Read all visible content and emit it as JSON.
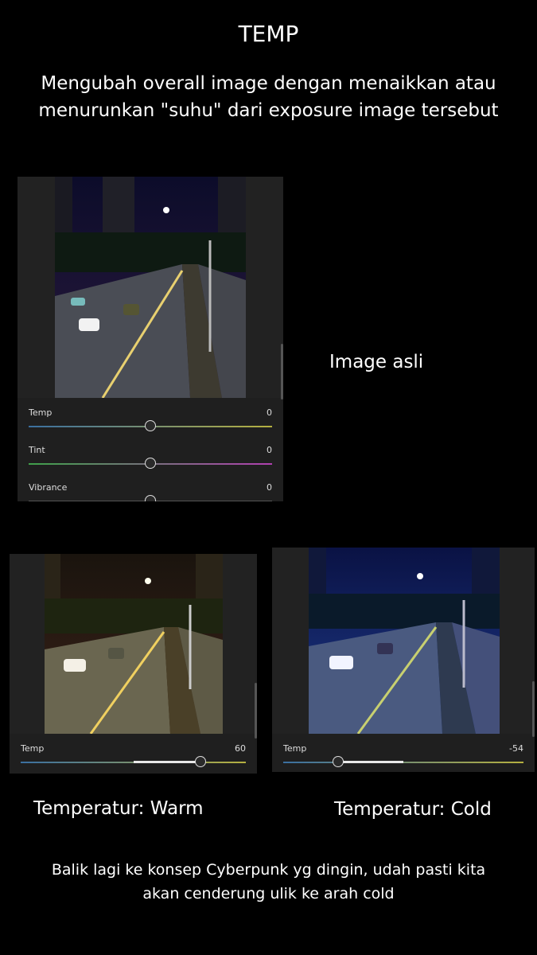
{
  "title": "TEMP",
  "subtitle": "Mengubah overall image dengan menaikkan atau menurunkan \"suhu\" dari exposure image tersebut",
  "original": {
    "caption": "Image asli",
    "sliders": [
      {
        "label": "Temp",
        "value": "0",
        "position": 0.5,
        "gradient": [
          "#3a6fa0",
          "#b5b040"
        ]
      },
      {
        "label": "Tint",
        "value": "0",
        "position": 0.5,
        "gradient": [
          "#3fa04a",
          "#b040b0"
        ]
      },
      {
        "label": "Vibrance",
        "value": "0",
        "position": 0.5,
        "gradient": [
          "#555555",
          "#555555"
        ]
      }
    ]
  },
  "warm": {
    "caption": "Temperatur: Warm",
    "slider": {
      "label": "Temp",
      "value": "60",
      "position": 0.8,
      "gradient": [
        "#3a6fa0",
        "#b5b040"
      ]
    }
  },
  "cold": {
    "caption": "Temperatur: Cold",
    "slider": {
      "label": "Temp",
      "value": "-54",
      "position": 0.23,
      "gradient": [
        "#3a6fa0",
        "#b5b040"
      ]
    }
  },
  "footer": "Balik lagi ke konsep Cyberpunk yg dingin, udah pasti kita akan cenderung ulik ke arah cold"
}
